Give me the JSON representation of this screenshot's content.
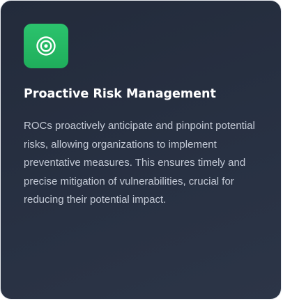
{
  "card": {
    "icon": "target-icon",
    "icon_color": "#ffffff",
    "badge_color": "#23b864",
    "title": "Proactive Risk Management",
    "description": "ROCs proactively anticipate and pinpoint potential risks, allowing organizations to implement preventative measures. This ensures timely and precise mitigation of vulnerabilities, crucial for reducing their potential impact."
  }
}
